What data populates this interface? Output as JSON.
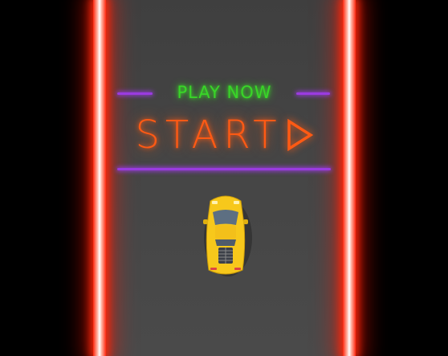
{
  "game": {
    "subtitle": "PLAY NOW",
    "start_label": "START",
    "play_icon": "play-triangle-icon"
  },
  "colors": {
    "subtitle": "#39d628",
    "start": "#ff5a14",
    "divider": "#9a3be0",
    "wall": "#ff2a10",
    "road": "#454545",
    "car_body": "#f7c81b"
  }
}
